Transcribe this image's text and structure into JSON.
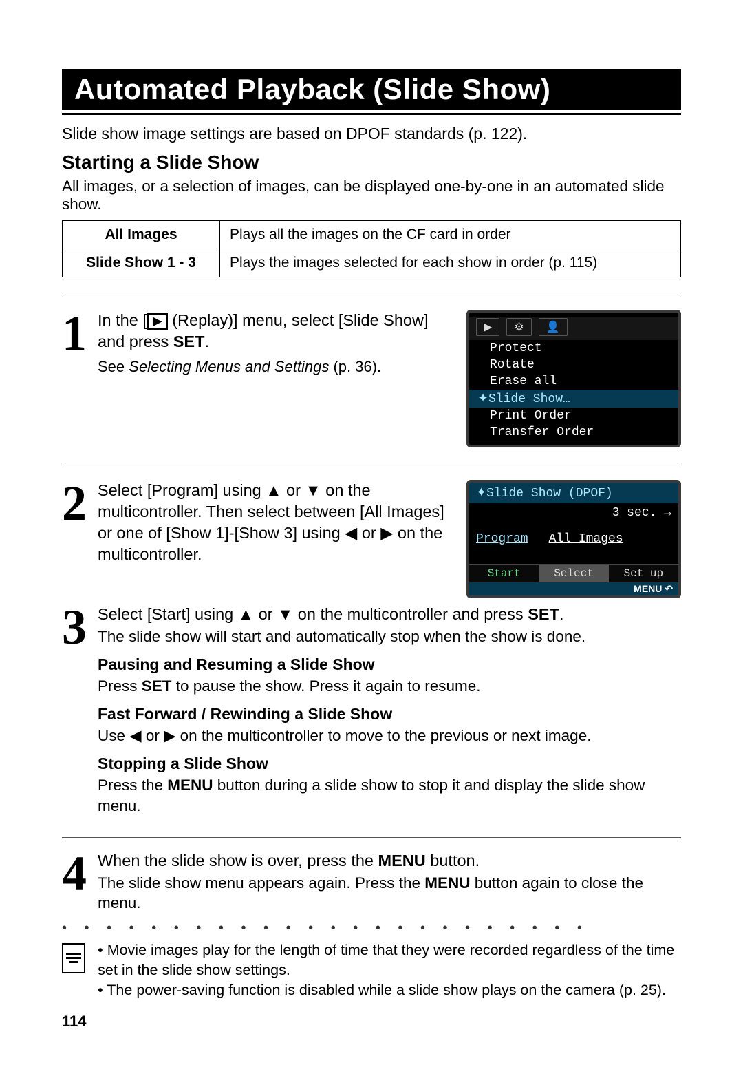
{
  "title": "Automated Playback (Slide Show)",
  "intro": "Slide show image settings are based on DPOF standards (p. 122).",
  "subhead": "Starting a Slide Show",
  "after_sub": "All images, or a selection of images, can be displayed one-by-one in an automated slide show.",
  "table": {
    "rows": [
      {
        "label": "All Images",
        "desc": "Plays all the images on the CF card in order"
      },
      {
        "label": "Slide Show 1 - 3",
        "desc": "Plays the images selected for each show in order (p. 115)"
      }
    ]
  },
  "steps": {
    "s1": {
      "num": "1",
      "line_a": "In the [",
      "line_b": " (Replay)] menu, select [Slide Show] and press ",
      "set": "SET",
      "period": ".",
      "sub_pre": "See ",
      "sub_it": "Selecting Menus and Settings",
      "sub_post": " (p. 36).",
      "lcd": {
        "tab_icons": [
          "▶",
          "⚙",
          "👤"
        ],
        "items": [
          "Protect",
          "Rotate",
          "Erase all",
          "Slide Show…",
          "Print Order",
          "Transfer Order"
        ],
        "selected_index": 3
      }
    },
    "s2": {
      "num": "2",
      "text_a": "Select [Program] using ",
      "up": "▲",
      "mid1": " or ",
      "down": "▼",
      "text_b": " on the multicontroller. Then select between [All Images] or one of [Show 1]-[Show 3] using ",
      "left": "◀",
      "mid2": " or ",
      "right": "▶",
      "text_c": " on the multicontroller.",
      "lcd": {
        "header": "Slide Show (DPOF)",
        "time": "3 sec. →",
        "program": "Program",
        "all_images": "All Images",
        "start": "Start",
        "select": "Select",
        "setup": "Set up",
        "menu": "MENU ↶"
      }
    },
    "s3": {
      "num": "3",
      "title_a": "Select [Start] using ",
      "up": "▲",
      "mid": " or ",
      "down": "▼",
      "title_b": " on the multicontroller and press ",
      "set": "SET",
      "period": ".",
      "p1": "The slide show will start and automatically stop when the show is done.",
      "h1": "Pausing and Resuming a Slide Show",
      "p2_a": "Press ",
      "p2_set": "SET",
      "p2_b": " to pause the show. Press it again to resume.",
      "h2": "Fast Forward / Rewinding a Slide Show",
      "p3_a": "Use ",
      "left": "◀",
      "p3_mid": " or ",
      "right": "▶",
      "p3_b": " on the multicontroller to move to the previous or next image.",
      "h3": "Stopping a Slide Show",
      "p4_a": "Press the ",
      "p4_menu": "MENU",
      "p4_b": " button during a slide show to stop it and display the slide show menu."
    },
    "s4": {
      "num": "4",
      "title_a": "When the slide show is over, press the ",
      "menu": "MENU",
      "title_b": " button.",
      "p_a": "The slide show menu appears again. Press the ",
      "p_menu": "MENU",
      "p_b": " button again to close the menu."
    }
  },
  "notes": {
    "n1": "Movie images play for the length of time that they were recorded regardless of the time set in the slide show settings.",
    "n2": "The power-saving function is disabled while a slide show plays on the camera (p. 25)."
  },
  "pagenum": "114"
}
